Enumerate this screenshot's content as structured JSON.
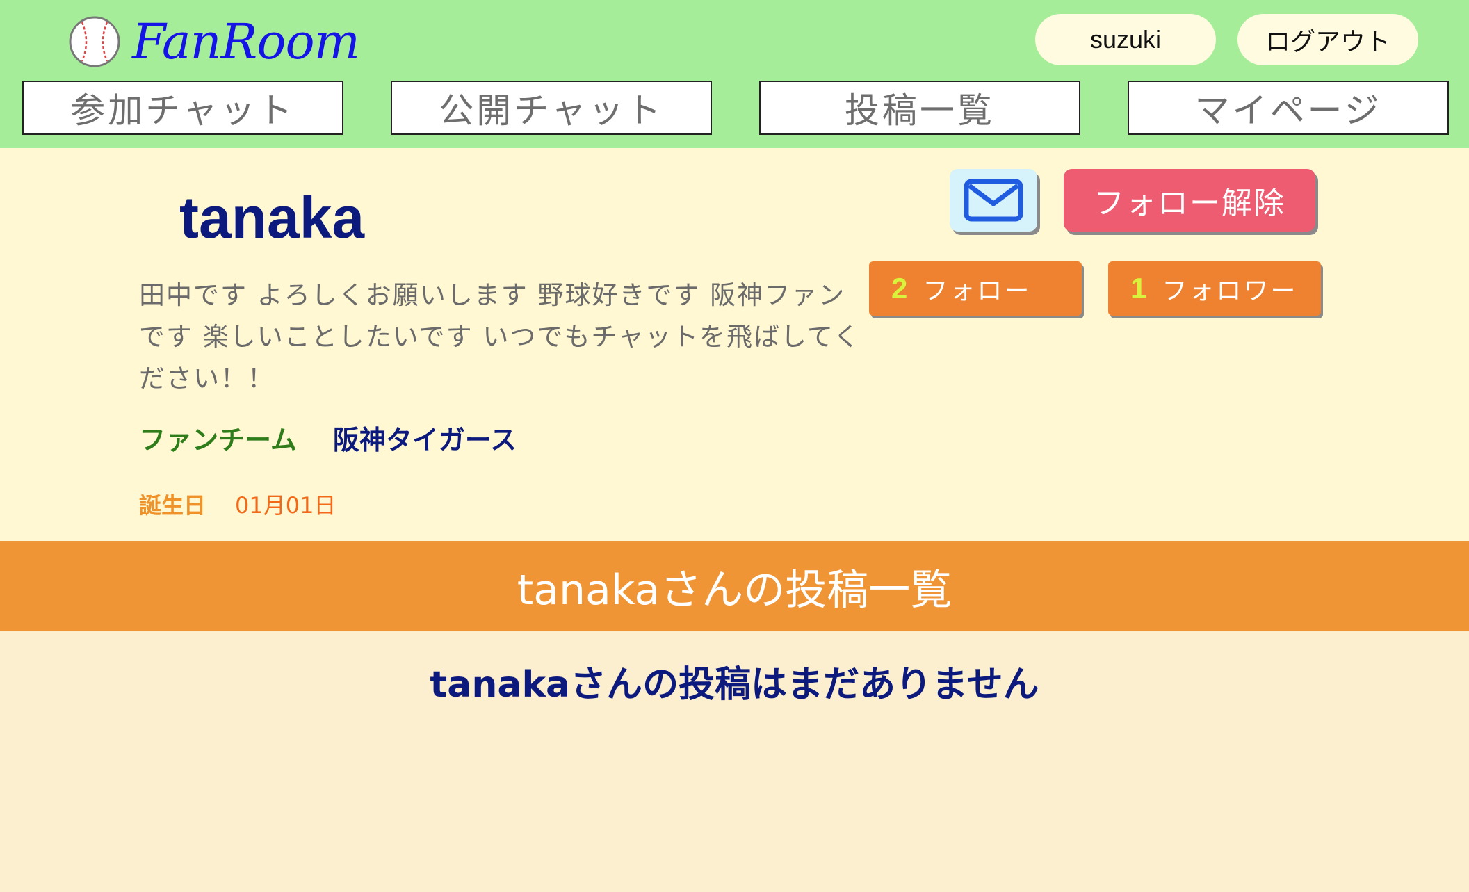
{
  "app": {
    "name": "FanRoom",
    "logo_icon": "baseball-icon"
  },
  "header": {
    "user_label": "suzuki",
    "logout_label": "ログアウト",
    "nav": [
      {
        "label": "参加チャット"
      },
      {
        "label": "公開チャット"
      },
      {
        "label": "投稿一覧"
      },
      {
        "label": "マイページ"
      }
    ]
  },
  "profile": {
    "username": "tanaka",
    "bio": "田中です よろしくお願いします 野球好きです 阪神ファンです 楽しいことしたいです いつでもチャットを飛ばしてください！！",
    "team_label": "ファンチーム",
    "team_name": "阪神タイガース",
    "birthday_label": "誕生日",
    "birthday_value": "01月01日",
    "message_icon": "mail-icon",
    "unfollow_label": "フォロー解除",
    "following_count": "2",
    "following_label": "フォロー",
    "followers_count": "1",
    "followers_label": "フォロワー"
  },
  "posts": {
    "header": "tanakaさんの投稿一覧",
    "empty_message": "tanakaさんの投稿はまだありません"
  },
  "colors": {
    "header_bg": "#a6ed9a",
    "profile_bg": "#fff8d3",
    "accent_orange": "#f09535",
    "unfollow_red": "#ed5c70",
    "navy": "#0b1a7c"
  }
}
